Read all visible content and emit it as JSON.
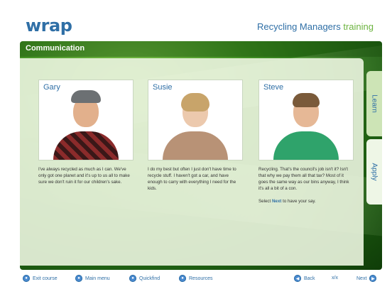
{
  "header": {
    "logo": "wrap",
    "title_main": "Recycling Managers",
    "title_accent": "training"
  },
  "section": {
    "title": "Communication"
  },
  "tabs": [
    {
      "label": "Learn"
    },
    {
      "label": "Apply"
    }
  ],
  "people": [
    {
      "name": "Gary",
      "quote": "I've always recycled as much as I can. We've only got one planet and it's up to us all to make sure we don't ruin it for our children's sake."
    },
    {
      "name": "Susie",
      "quote": "I do my best but often I just don't have time to recycle stuff. I haven't got a car, and have enough to carry with everything I need for the kids."
    },
    {
      "name": "Steve",
      "quote": "Recycling. That's the council's job isn't it? Isn't that why we pay them all that tax? Most of it goes the same way as our bins anyway, I think it's all a bit of a con.",
      "instruction_prefix": "Select",
      "instruction_bold": "Next",
      "instruction_suffix": "to have your say."
    }
  ],
  "footer": {
    "exit": "Exit course",
    "main_menu": "Main menu",
    "quickfind": "Quickfind",
    "resources": "Resources",
    "back": "Back",
    "pager": "x/x",
    "next": "Next"
  },
  "colors": {
    "brand_blue": "#2f6fa6",
    "accent_green": "#6cb33f"
  }
}
